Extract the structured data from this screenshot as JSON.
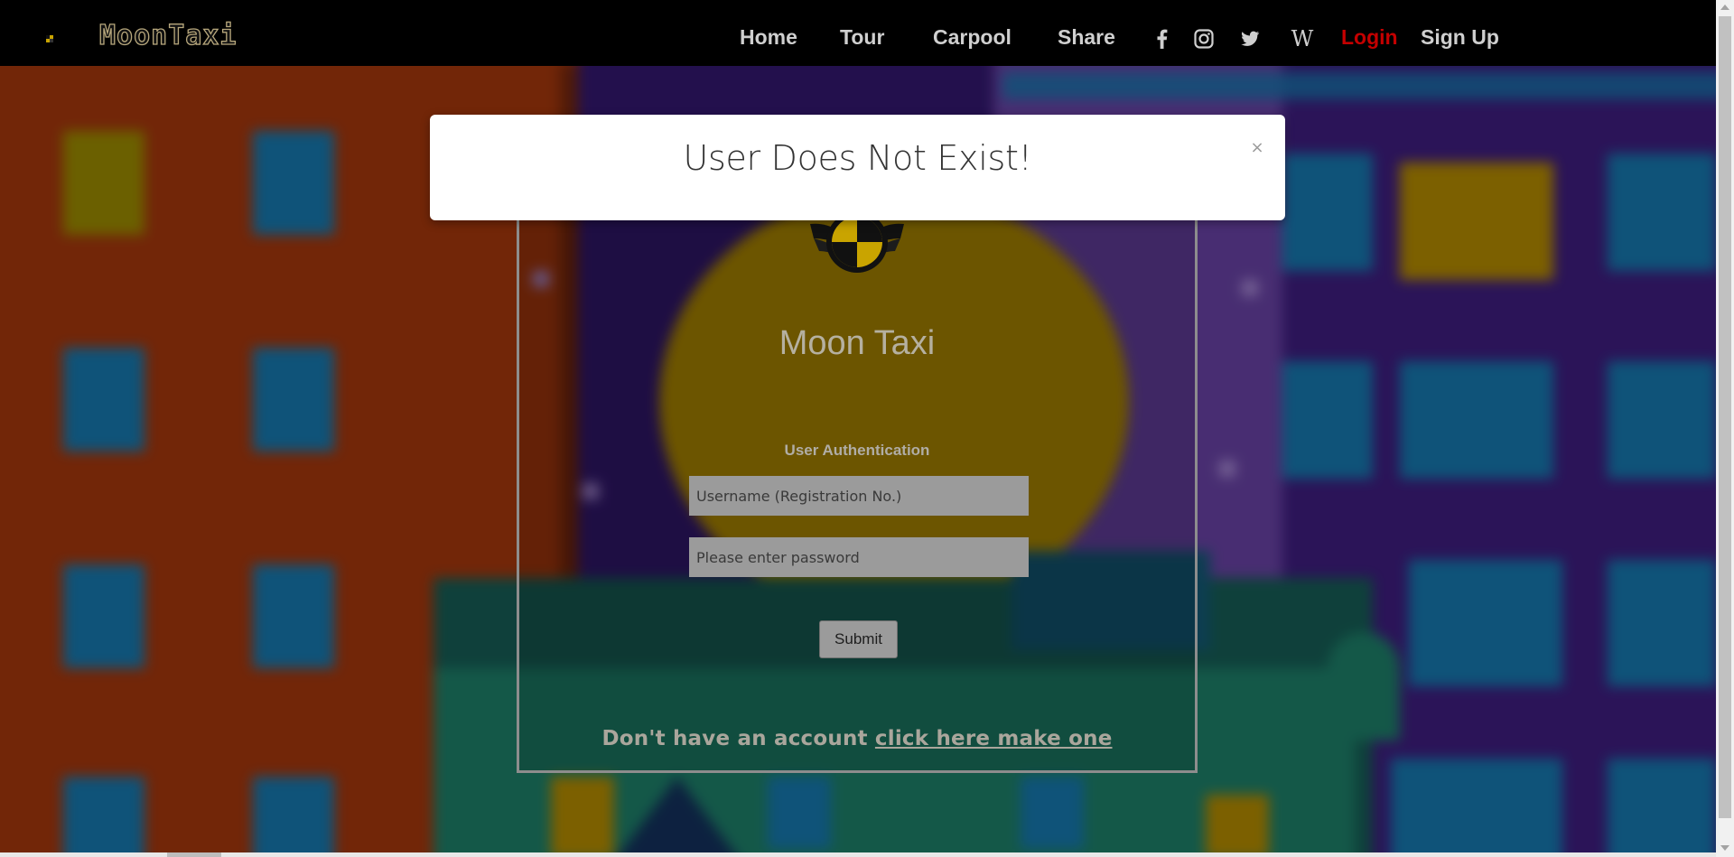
{
  "brand": {
    "name": "MoonTaxi",
    "icon": "taxi-checker-icon"
  },
  "nav": {
    "links": [
      "Home",
      "Tour",
      "Carpool",
      "Share"
    ],
    "social": [
      "facebook-icon",
      "instagram-icon",
      "twitter-icon",
      "wikipedia-icon"
    ],
    "wiki_glyph": "W",
    "login": "Login",
    "signup": "Sign Up"
  },
  "panel": {
    "title": "Moon Taxi",
    "auth_label": "User Authentication",
    "username_placeholder": "Username (Registration No.)",
    "password_placeholder": "Please enter password",
    "submit": "Submit",
    "prompt_text": "Don't have an account ",
    "prompt_link": "click here make one"
  },
  "alert": {
    "message": "User Does Not Exist!",
    "close": "×"
  },
  "colors": {
    "login_red": "#c40000",
    "nav_text": "#cfcfcf",
    "modal_bg": "#ffffff"
  }
}
